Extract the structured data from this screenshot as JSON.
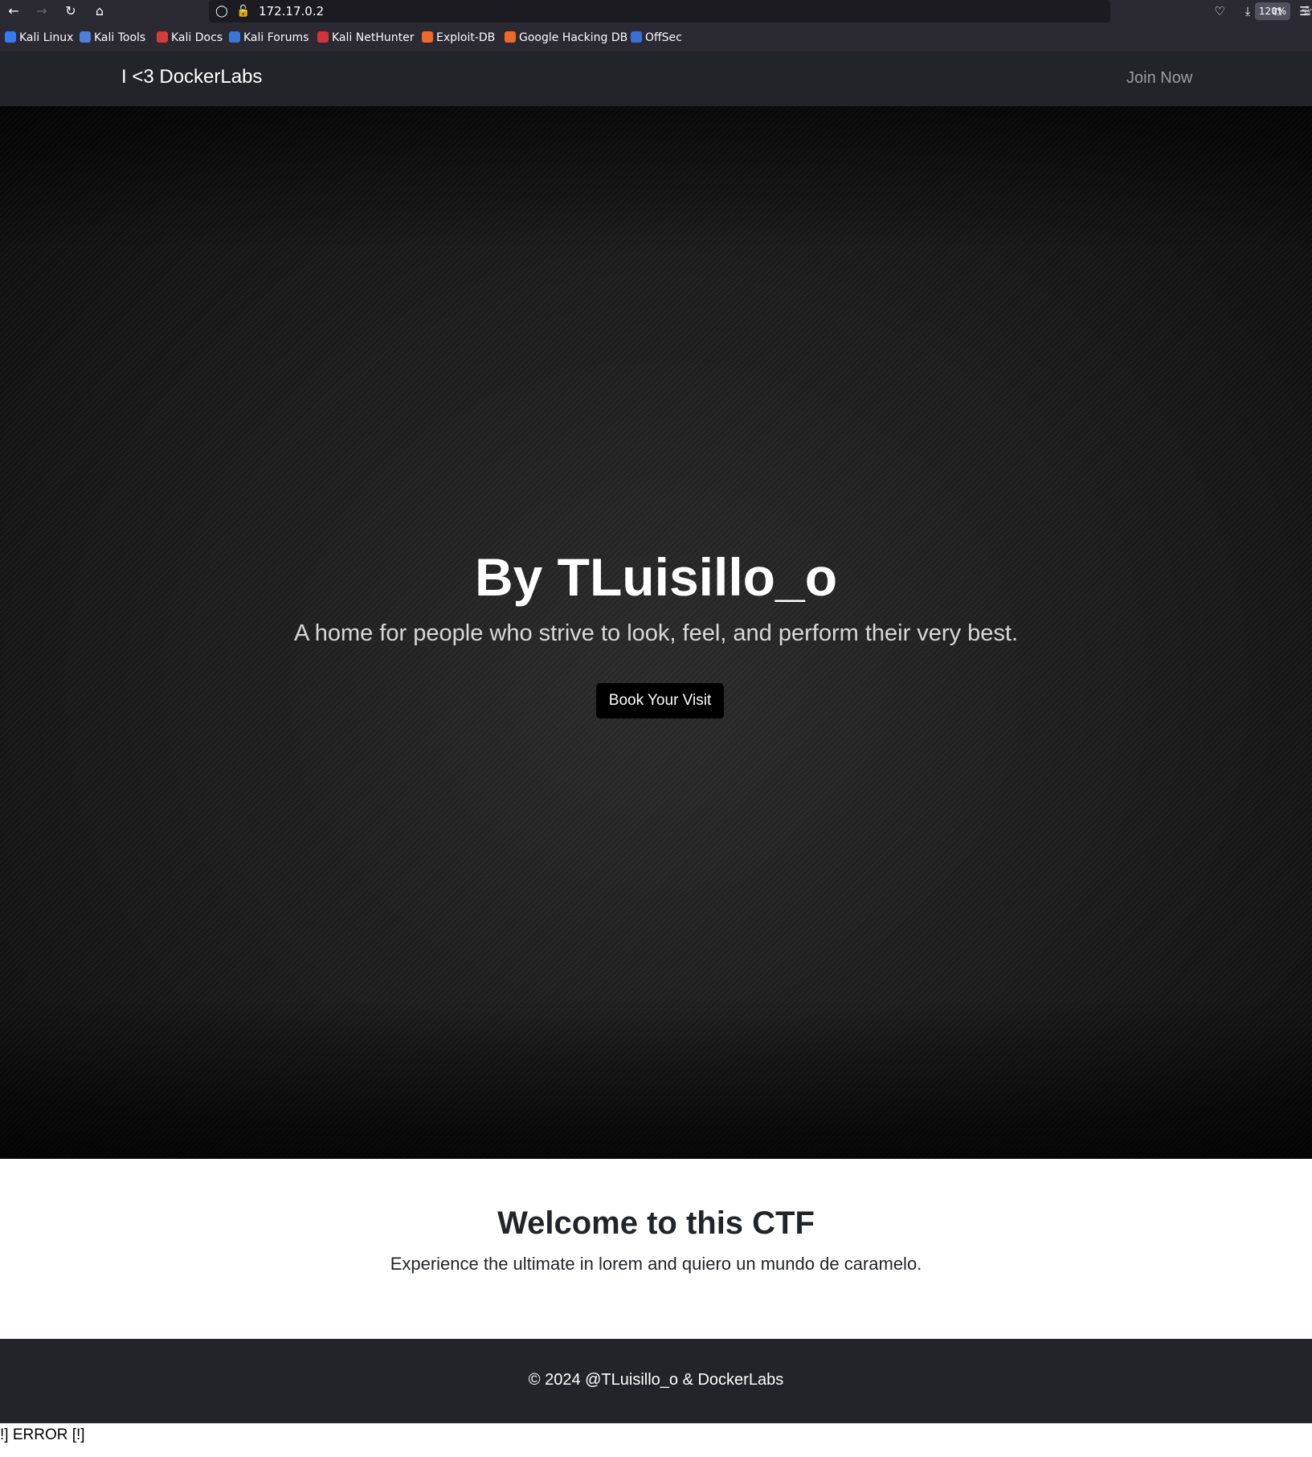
{
  "browser": {
    "url": "172.17.0.2",
    "zoom": "120%",
    "bookmarks": [
      {
        "label": "Kali Linux",
        "color": "#367bf0"
      },
      {
        "label": "Kali Tools",
        "color": "#4f7fd6"
      },
      {
        "label": "Kali Docs",
        "color": "#d43c3c"
      },
      {
        "label": "Kali Forums",
        "color": "#3a76d8"
      },
      {
        "label": "Kali NetHunter",
        "color": "#d0343a"
      },
      {
        "label": "Exploit-DB",
        "color": "#ef6a2a"
      },
      {
        "label": "Google Hacking DB",
        "color": "#ef6a2a"
      },
      {
        "label": "OffSec",
        "color": "#3a6fd8"
      }
    ]
  },
  "site": {
    "brand": "I <3 DockerLabs",
    "nav_link": "Join Now",
    "hero": {
      "title": "By TLuisillo_o",
      "subtitle": "A home for people who strive to look, feel, and perform their very best.",
      "button": "Book Your Visit"
    },
    "welcome": {
      "title": "Welcome to this CTF",
      "text": "Experience the ultimate in lorem and quiero un mundo de caramelo."
    },
    "footer": "© 2024 @TLuisillo_o & DockerLabs"
  },
  "error_text": "!] ERROR [!]",
  "colors": {
    "navbar": "#212529",
    "button": "#000000",
    "footer": "#212529"
  }
}
